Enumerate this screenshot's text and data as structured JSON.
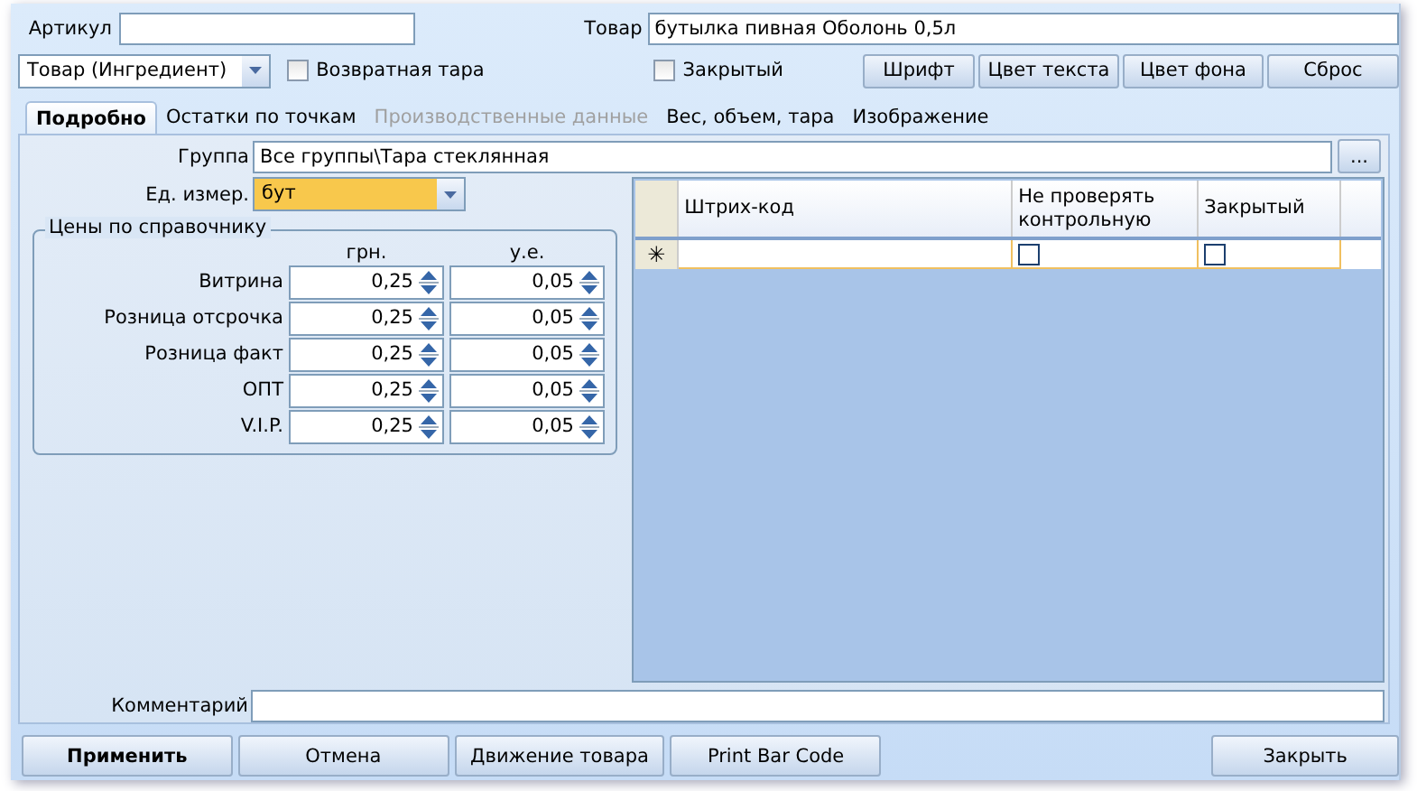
{
  "article": {
    "label": "Артикул"
  },
  "product": {
    "label": "Товар",
    "value": "бутылка пивная Оболонь 0,5л"
  },
  "type_combo": {
    "value": "Товар (Ингредиент)"
  },
  "checkboxes": [
    {
      "label": "Возвратная тара",
      "checked": false
    },
    {
      "label": "Закрытый",
      "checked": false
    }
  ],
  "style_buttons": [
    "Шрифт",
    "Цвет текста",
    "Цвет фона",
    "Сброс"
  ],
  "tabs": [
    {
      "label": "Подробно",
      "selected": true,
      "disabled": false
    },
    {
      "label": "Остатки по точкам",
      "selected": false,
      "disabled": false
    },
    {
      "label": "Производственные данные",
      "selected": false,
      "disabled": true
    },
    {
      "label": "Вес, объем, тара",
      "selected": false,
      "disabled": false
    },
    {
      "label": "Изображение",
      "selected": false,
      "disabled": false
    }
  ],
  "group": {
    "label": "Группа",
    "value": "Все группы\\Тара стеклянная",
    "button": "..."
  },
  "unit": {
    "label": "Ед. измер.",
    "value": "бут",
    "highlighted": true
  },
  "prices": {
    "title": "Цены по справочнику",
    "columns": [
      "грн.",
      "у.е."
    ],
    "rows": [
      {
        "label": "Витрина",
        "values": [
          "0,25",
          "0,05"
        ]
      },
      {
        "label": "Розница отсрочка",
        "values": [
          "0,25",
          "0,05"
        ]
      },
      {
        "label": "Розница факт",
        "values": [
          "0,25",
          "0,05"
        ]
      },
      {
        "label": "ОПТ",
        "values": [
          "0,25",
          "0,05"
        ]
      },
      {
        "label": "V.I.P.",
        "values": [
          "0,25",
          "0,05"
        ]
      }
    ]
  },
  "barcode_table": {
    "columns": [
      {
        "label": "Штрих-код"
      },
      {
        "label": "Не проверять контрольную"
      },
      {
        "label": "Закрытый"
      }
    ],
    "new_row": {
      "marker": "✳",
      "cells": [
        {
          "kind": "text"
        },
        {
          "kind": "checkbox",
          "checked": false
        },
        {
          "kind": "checkbox",
          "checked": false
        }
      ]
    }
  },
  "comment": {
    "label": "Комментарий"
  },
  "buttons": [
    {
      "label": "Применить",
      "default": true
    },
    {
      "label": "Отмена",
      "default": false
    },
    {
      "label": "Движение товара",
      "default": false
    },
    {
      "label": "Print Bar Code",
      "default": false
    },
    {
      "label": "Закрыть",
      "default": false
    }
  ]
}
